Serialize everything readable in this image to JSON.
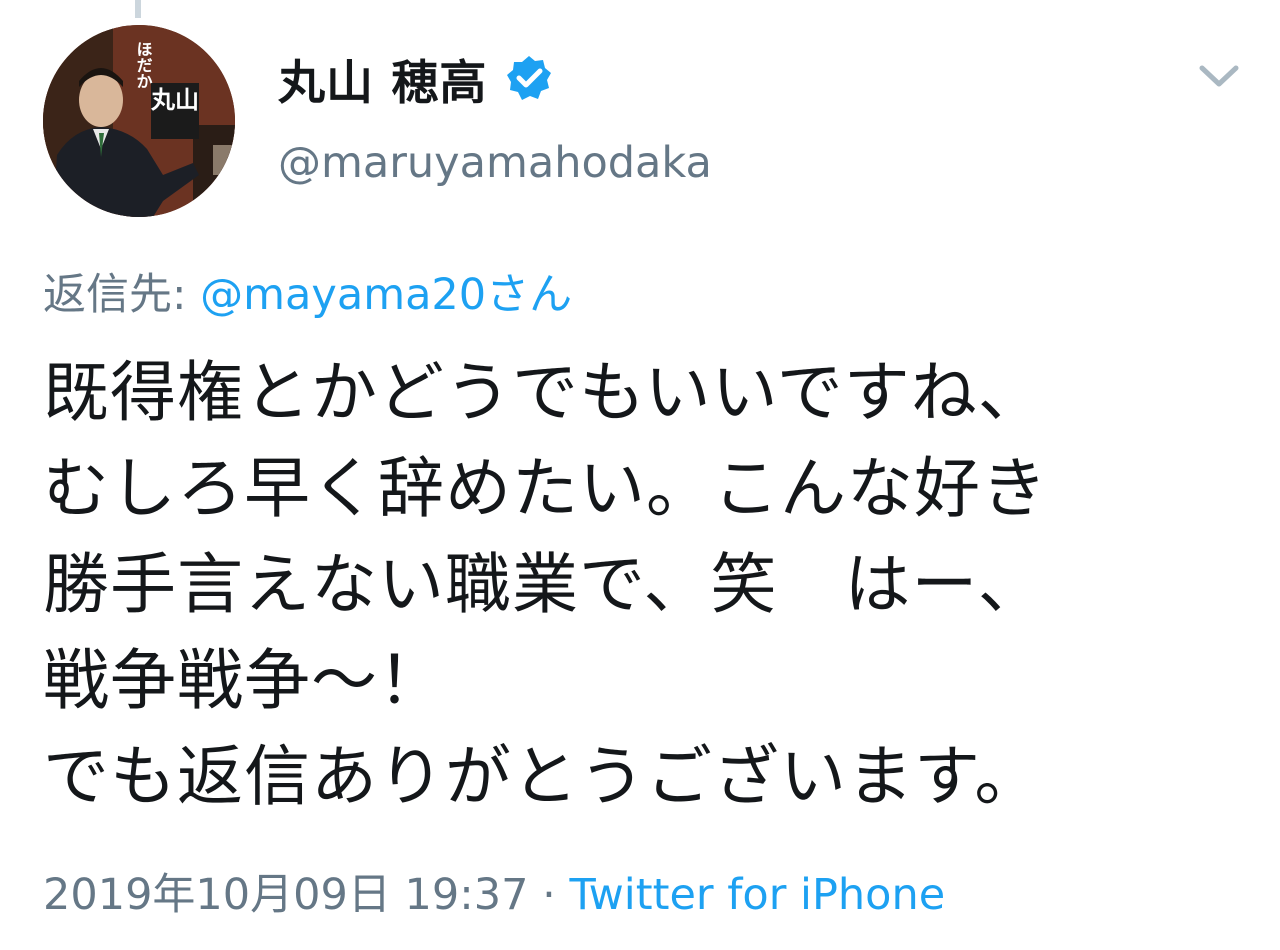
{
  "tweet": {
    "display_name": "丸山 穂高",
    "handle": "@maruyamahodaka",
    "verified": true,
    "reply_label": "返信先: ",
    "reply_mention": "@mayama20さん",
    "text": "既得権とかどうでもいいですね、\nむしろ早く辞めたい。こんな好き\n勝手言えない職業で、笑　はー、\n戦争戦争〜！\nでも返信ありがとうございます。",
    "timestamp": "2019年10月09日 19:37",
    "separator": " · ",
    "source": "Twitter for iPhone",
    "avatar_text": {
      "line1": "丸山",
      "line2": "ほだか"
    }
  },
  "colors": {
    "text": "#14171a",
    "secondary": "#657786",
    "accent": "#1da1f2",
    "thread_line": "#ccd6dd"
  },
  "icons": {
    "verified": "verified-badge-icon",
    "menu": "chevron-down-icon"
  }
}
